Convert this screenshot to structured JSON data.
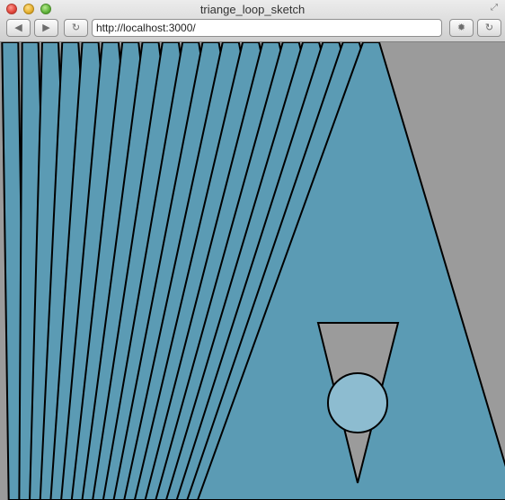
{
  "window": {
    "title": "triange_loop_sketch"
  },
  "toolbar": {
    "back_icon": "back-arrow-icon",
    "forward_icon": "forward-arrow-icon",
    "reload_icon": "reload-icon",
    "settings_icon": "gear-icon",
    "refresh_icon": "reload-icon",
    "back_glyph": "◀",
    "forward_glyph": "▶",
    "reload_glyph": "↻",
    "settings_glyph": "✹",
    "refresh_glyph": "↻"
  },
  "address": {
    "url": "http://localhost:3000/"
  },
  "sketch": {
    "background_color": "#9b9b9b",
    "triangle_color": "#5b9bb4",
    "stroke_color": "#000000",
    "inner_triangle_color": "#9b9b9b",
    "circle_color": "#8dbcd0",
    "triangle_count": 20
  }
}
